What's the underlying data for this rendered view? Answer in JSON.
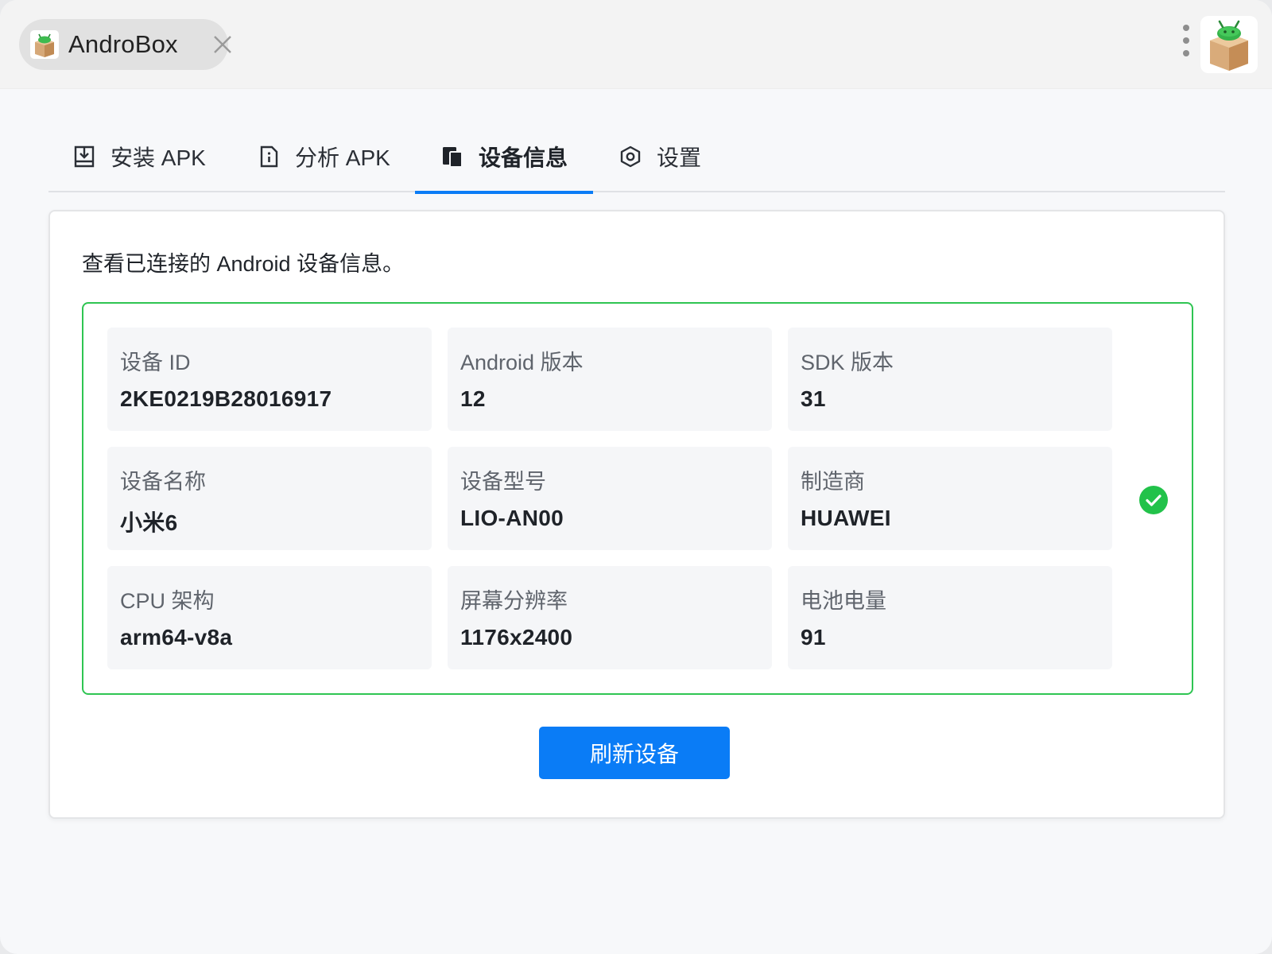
{
  "app": {
    "tab_title": "AndroBox",
    "tab_icon": "androbox-logo-icon",
    "close_icon": "close-icon",
    "menu_icon": "more-vertical-icon"
  },
  "nav": {
    "tabs": [
      {
        "label": "安装 APK",
        "icon": "install-icon",
        "active": false
      },
      {
        "label": "分析 APK",
        "icon": "document-info-icon",
        "active": false
      },
      {
        "label": "设备信息",
        "icon": "device-icon",
        "active": true
      },
      {
        "label": "设置",
        "icon": "settings-icon",
        "active": false
      }
    ]
  },
  "main": {
    "description": "查看已连接的 Android 设备信息。",
    "device": {
      "status": "connected",
      "status_icon": "check-circle-icon",
      "fields": [
        {
          "label": "设备 ID",
          "value": "2KE0219B28016917"
        },
        {
          "label": "Android 版本",
          "value": "12"
        },
        {
          "label": "SDK 版本",
          "value": "31"
        },
        {
          "label": "设备名称",
          "value": "小米6"
        },
        {
          "label": "设备型号",
          "value": "LIO-AN00"
        },
        {
          "label": "制造商",
          "value": "HUAWEI"
        },
        {
          "label": "CPU 架构",
          "value": "arm64-v8a"
        },
        {
          "label": "屏幕分辨率",
          "value": "1176x2400"
        },
        {
          "label": "电池电量",
          "value": "91"
        }
      ]
    },
    "refresh_button": "刷新设备"
  },
  "colors": {
    "accent": "#0a7cf6",
    "success": "#2fc552",
    "text": "#1f2329",
    "muted": "#5f646c"
  }
}
